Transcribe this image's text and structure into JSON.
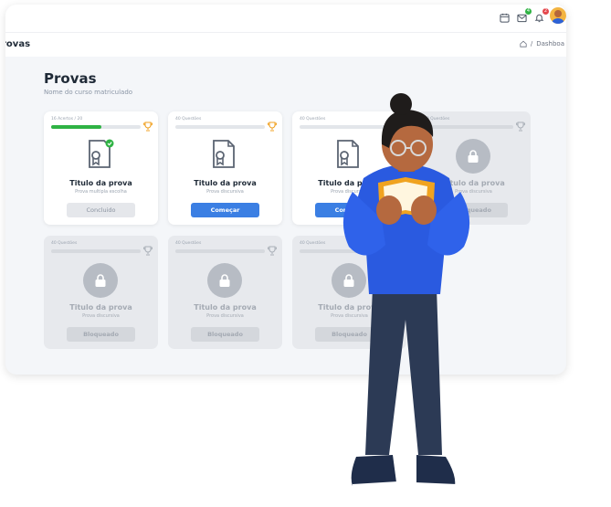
{
  "topbar": {
    "icons": [
      "calendar-icon",
      "mail-icon",
      "bell-icon"
    ],
    "mail_badge": "4",
    "bell_badge": "2",
    "mail_badge_color": "#2fb344",
    "bell_badge_color": "#e5484d"
  },
  "header": {
    "page_label": "rovas",
    "breadcrumb_sep": "/",
    "breadcrumb_item": "Dashboa"
  },
  "main": {
    "title": "Provas",
    "subtitle": "Nome do curso matriculado"
  },
  "cards": [
    {
      "meta": "16 Acertos / 20",
      "progress": 0.56,
      "title": "Titulo da prova",
      "subtitle": "Prova multipla escolha",
      "button": "Concluido",
      "state": "done"
    },
    {
      "meta": "40 Questões",
      "progress": 0,
      "title": "Titulo da prova",
      "subtitle": "Prova discursiva",
      "button": "Começar",
      "state": "start"
    },
    {
      "meta": "40 Questões",
      "progress": 0,
      "title": "Titulo da prova",
      "subtitle": "Prova discursiva",
      "button": "Começar",
      "state": "start"
    },
    {
      "meta": "40 Questões",
      "progress": 0,
      "title": "Titulo da prova",
      "subtitle": "Prova discursiva",
      "button": "Bloqueado",
      "state": "locked"
    },
    {
      "meta": "40 Questões",
      "progress": 0,
      "title": "Titulo da prova",
      "subtitle": "Prova discursiva",
      "button": "Bloqueado",
      "state": "locked"
    },
    {
      "meta": "40 Questões",
      "progress": 0,
      "title": "Titulo da prova",
      "subtitle": "Prova discursiva",
      "button": "Bloqueado",
      "state": "locked"
    },
    {
      "meta": "40 Questões",
      "progress": 0,
      "title": "Titulo da prova",
      "subtitle": "Prova discursiva",
      "button": "Bloqueado",
      "state": "locked"
    }
  ],
  "colors": {
    "accent": "#3b7fe3",
    "success": "#2fb344",
    "trophy": "#f0a020",
    "trophy_locked": "#aab0b8"
  }
}
